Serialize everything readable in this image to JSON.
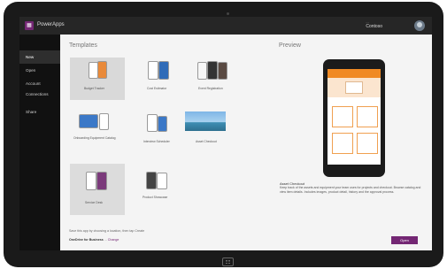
{
  "topbar": {
    "app_title": "PowerApps",
    "account_line": "...",
    "org": "Contoso",
    "logo_glyph": "▦"
  },
  "sidebar": {
    "items": [
      {
        "label": "New"
      },
      {
        "label": "Open"
      },
      {
        "label": "Account"
      },
      {
        "label": "Connections"
      },
      {
        "label": "Share"
      }
    ]
  },
  "templates": {
    "heading": "Templates",
    "items": [
      {
        "caption": "Budget Tracker"
      },
      {
        "caption": "Cost Estimator"
      },
      {
        "caption": "Event Registration"
      },
      {
        "caption": "Onboarding Equipment Catalog"
      },
      {
        "caption": "Interview Scheduler"
      },
      {
        "caption": "Asset Checkout"
      },
      {
        "caption": "Service Desk"
      },
      {
        "caption": "Product Showcase"
      }
    ]
  },
  "preview": {
    "heading": "Preview",
    "title": "Asset Checkout",
    "description": "Keep track of the assets and equipment your team uses for projects and checkout. Browse catalog and view item details. Includes images, product detail, history and the approval process."
  },
  "footer": {
    "line1": "Save this app by choosing a location, then tap Create",
    "label": "OneDrive for Business",
    "path": "...",
    "change": "Change",
    "open_button": "Open"
  },
  "colors": {
    "accent": "#742774",
    "sidebar": "#111111",
    "topbar": "#262626"
  }
}
